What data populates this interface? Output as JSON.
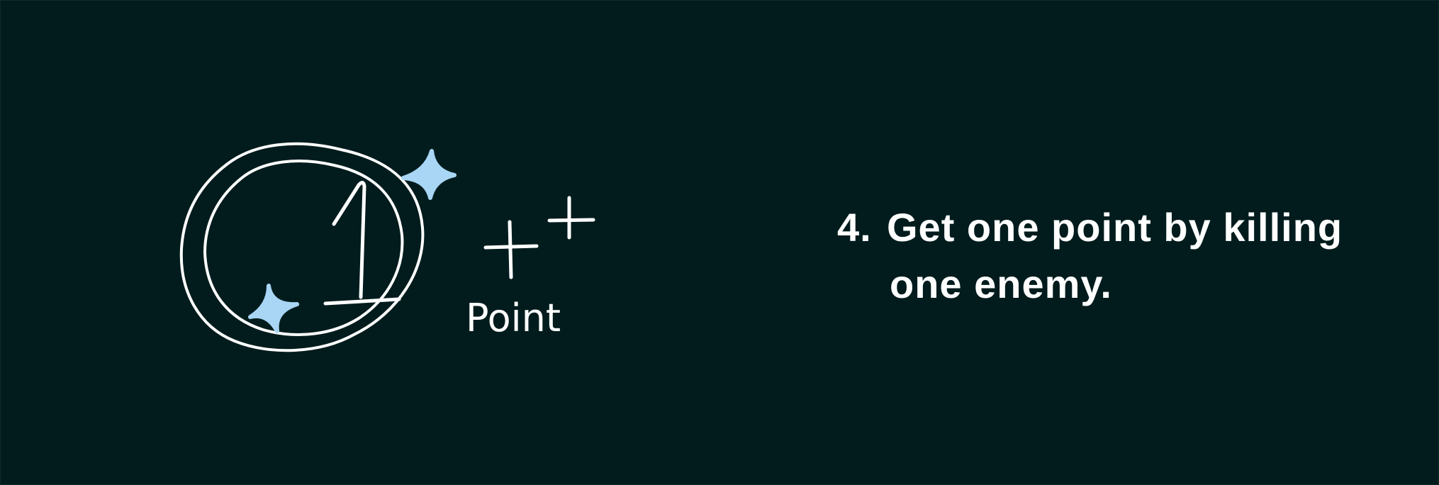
{
  "illustration": {
    "coin_label": "1",
    "point_label": "Point",
    "colors": {
      "stroke": "#ffffff",
      "sparkle": "#a9d6f5",
      "background": "#021c1d"
    },
    "icons": [
      "coin-icon",
      "sparkle-icon",
      "plus-icon"
    ]
  },
  "instruction": {
    "number": "4.",
    "line1": "Get one point by killing",
    "line2": "one enemy."
  }
}
